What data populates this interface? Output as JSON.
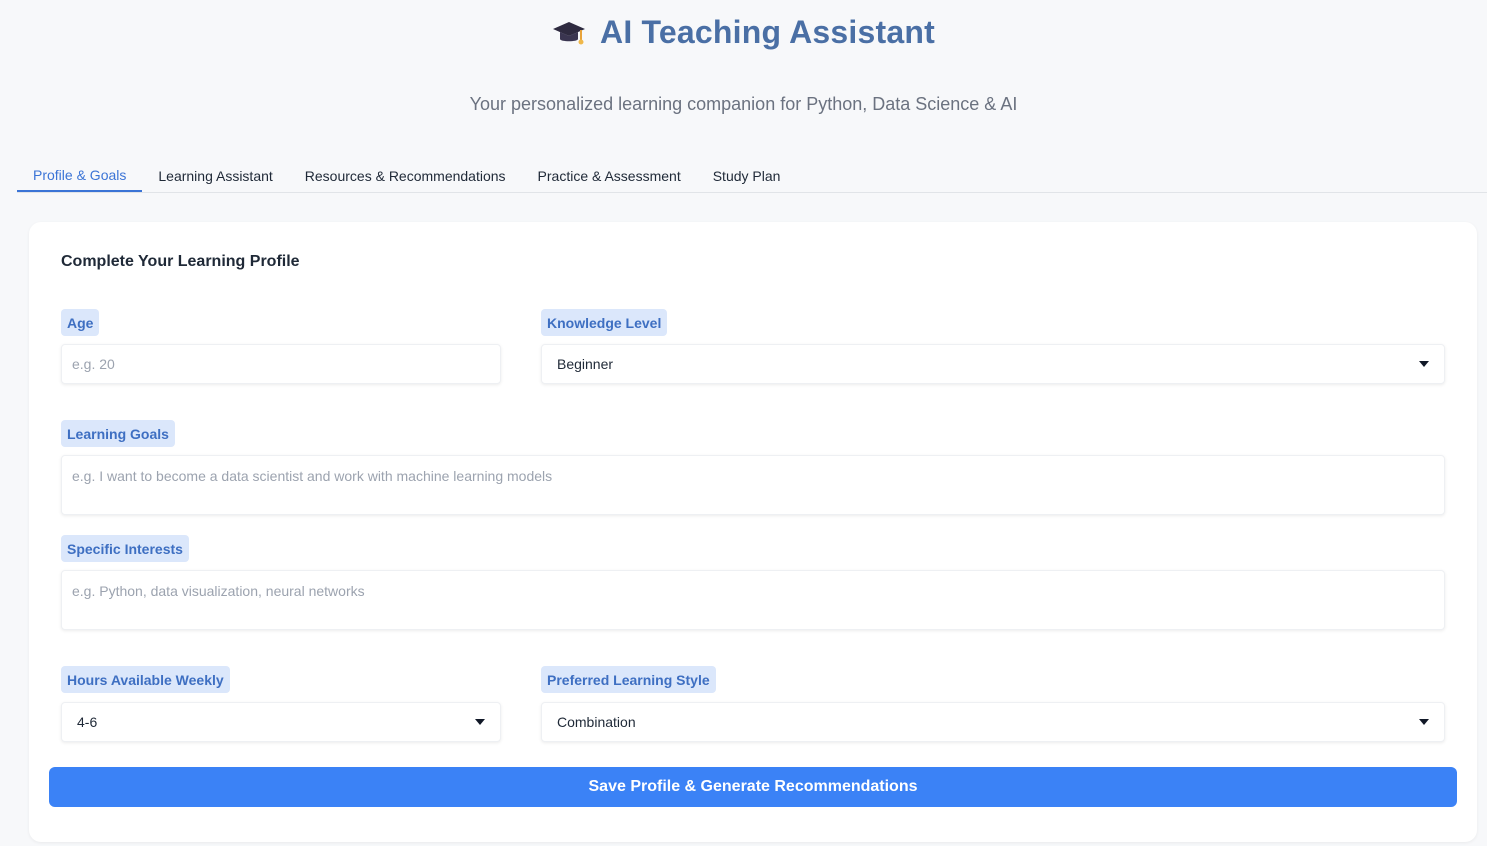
{
  "header": {
    "icon": "graduation-cap-icon",
    "title": "AI Teaching Assistant",
    "subtitle": "Your personalized learning companion for Python, Data Science & AI"
  },
  "tabs": [
    {
      "label": "Profile & Goals",
      "active": true
    },
    {
      "label": "Learning Assistant",
      "active": false
    },
    {
      "label": "Resources & Recommendations",
      "active": false
    },
    {
      "label": "Practice & Assessment",
      "active": false
    },
    {
      "label": "Study Plan",
      "active": false
    }
  ],
  "form": {
    "title": "Complete Your Learning Profile",
    "age": {
      "label": "Age",
      "value": "",
      "placeholder": "e.g. 20"
    },
    "knowledge_level": {
      "label": "Knowledge Level",
      "value": "Beginner"
    },
    "learning_goals": {
      "label": "Learning Goals",
      "value": "",
      "placeholder": "e.g. I want to become a data scientist and work with machine learning models"
    },
    "specific_interests": {
      "label": "Specific Interests",
      "value": "",
      "placeholder": "e.g. Python, data visualization, neural networks"
    },
    "hours_weekly": {
      "label": "Hours Available Weekly",
      "value": "4-6"
    },
    "learning_style": {
      "label": "Preferred Learning Style",
      "value": "Combination"
    },
    "submit_label": "Save Profile & Generate Recommendations"
  },
  "colors": {
    "accent": "#3b82f6",
    "title": "#4a6fa5",
    "label_bg": "#dbe7fb",
    "label_text": "#3e6fc2",
    "background": "#f7f8fa"
  }
}
